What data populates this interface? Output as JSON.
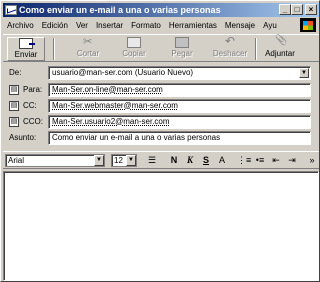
{
  "window": {
    "title": "Como enviar un e-mail a una o varias personas",
    "controls": {
      "minimize": "_",
      "maximize": "□",
      "close": "×"
    }
  },
  "menu": [
    "Archivo",
    "Edición",
    "Ver",
    "Insertar",
    "Formato",
    "Herramientas",
    "Mensaje",
    "Ayu"
  ],
  "toolbar": {
    "send": "Enviar",
    "cut": "Cortar",
    "copy": "Copiar",
    "paste": "Pegar",
    "undo": "Deshacer",
    "attach": "Adjuntar"
  },
  "headers": {
    "from_label": "De:",
    "from_value": "usuario@man-ser.com   (Usuario Nuevo)",
    "to_label": "Para:",
    "to_value": "Man-Ser.on-line@man-ser.com",
    "cc_label": "CC:",
    "cc_value": "Man-Ser.webmaster@man-ser.com",
    "bcc_label": "CCO:",
    "bcc_value": "Man-Ser.usuario2@man-ser.com",
    "subject_label": "Asunto:",
    "subject_value": "Como enviar un e-mail a una o varias personas"
  },
  "format": {
    "font": "Arial",
    "size": "12",
    "bold": "N",
    "italic": "K",
    "underline": "S",
    "color": "A"
  },
  "body_text": ""
}
